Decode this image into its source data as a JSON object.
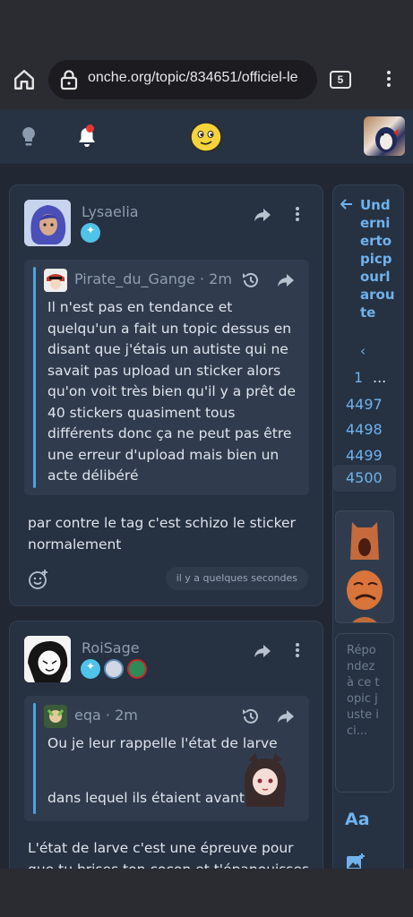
{
  "browser": {
    "url": "onche.org/topic/834651/officiel-le",
    "tab_count": "5"
  },
  "post1": {
    "author": "Lysaelia",
    "quote": {
      "author": "Pirate_du_Gange",
      "time": "· 2m",
      "text": "Il n'est pas en tendance et quelqu'un a fait un topic dessus en disant que j'étais un autiste qui ne savait pas upload un sticker alors qu'on voit très bien qu'il y a prêt de 40 stickers quasiment tous différents donc ça ne peut pas être une erreur d'upload mais bien un acte délibéré"
    },
    "text": "par contre le tag c'est schizo le sticker normalement",
    "time_chip": "il y a quelques secondes"
  },
  "post2": {
    "author": "RoiSage",
    "quote": {
      "author": "eqa",
      "time": "· 2m",
      "line1": "Ou je leur rappelle l'état de larve",
      "line2": "dans lequel ils étaient avant"
    },
    "text": "L'état de larve c'est une épreuve pour que tu brises ton cocon et t'épanouisses"
  },
  "sidebar": {
    "title": "Underniertopicpourlaroute",
    "prev": "‹",
    "first_page": "1",
    "dots": "...",
    "pages": [
      "4497",
      "4498",
      "4499",
      "4500"
    ],
    "current_page": "4500",
    "reply_placeholder": "Répondez à ce topic juste ici...",
    "format_label": "Aa"
  },
  "colors": {
    "accent": "#6fb2ee",
    "background": "#212834",
    "card": "#263141",
    "quote_bar": "#4aa3df",
    "notification_dot": "#e53935"
  }
}
